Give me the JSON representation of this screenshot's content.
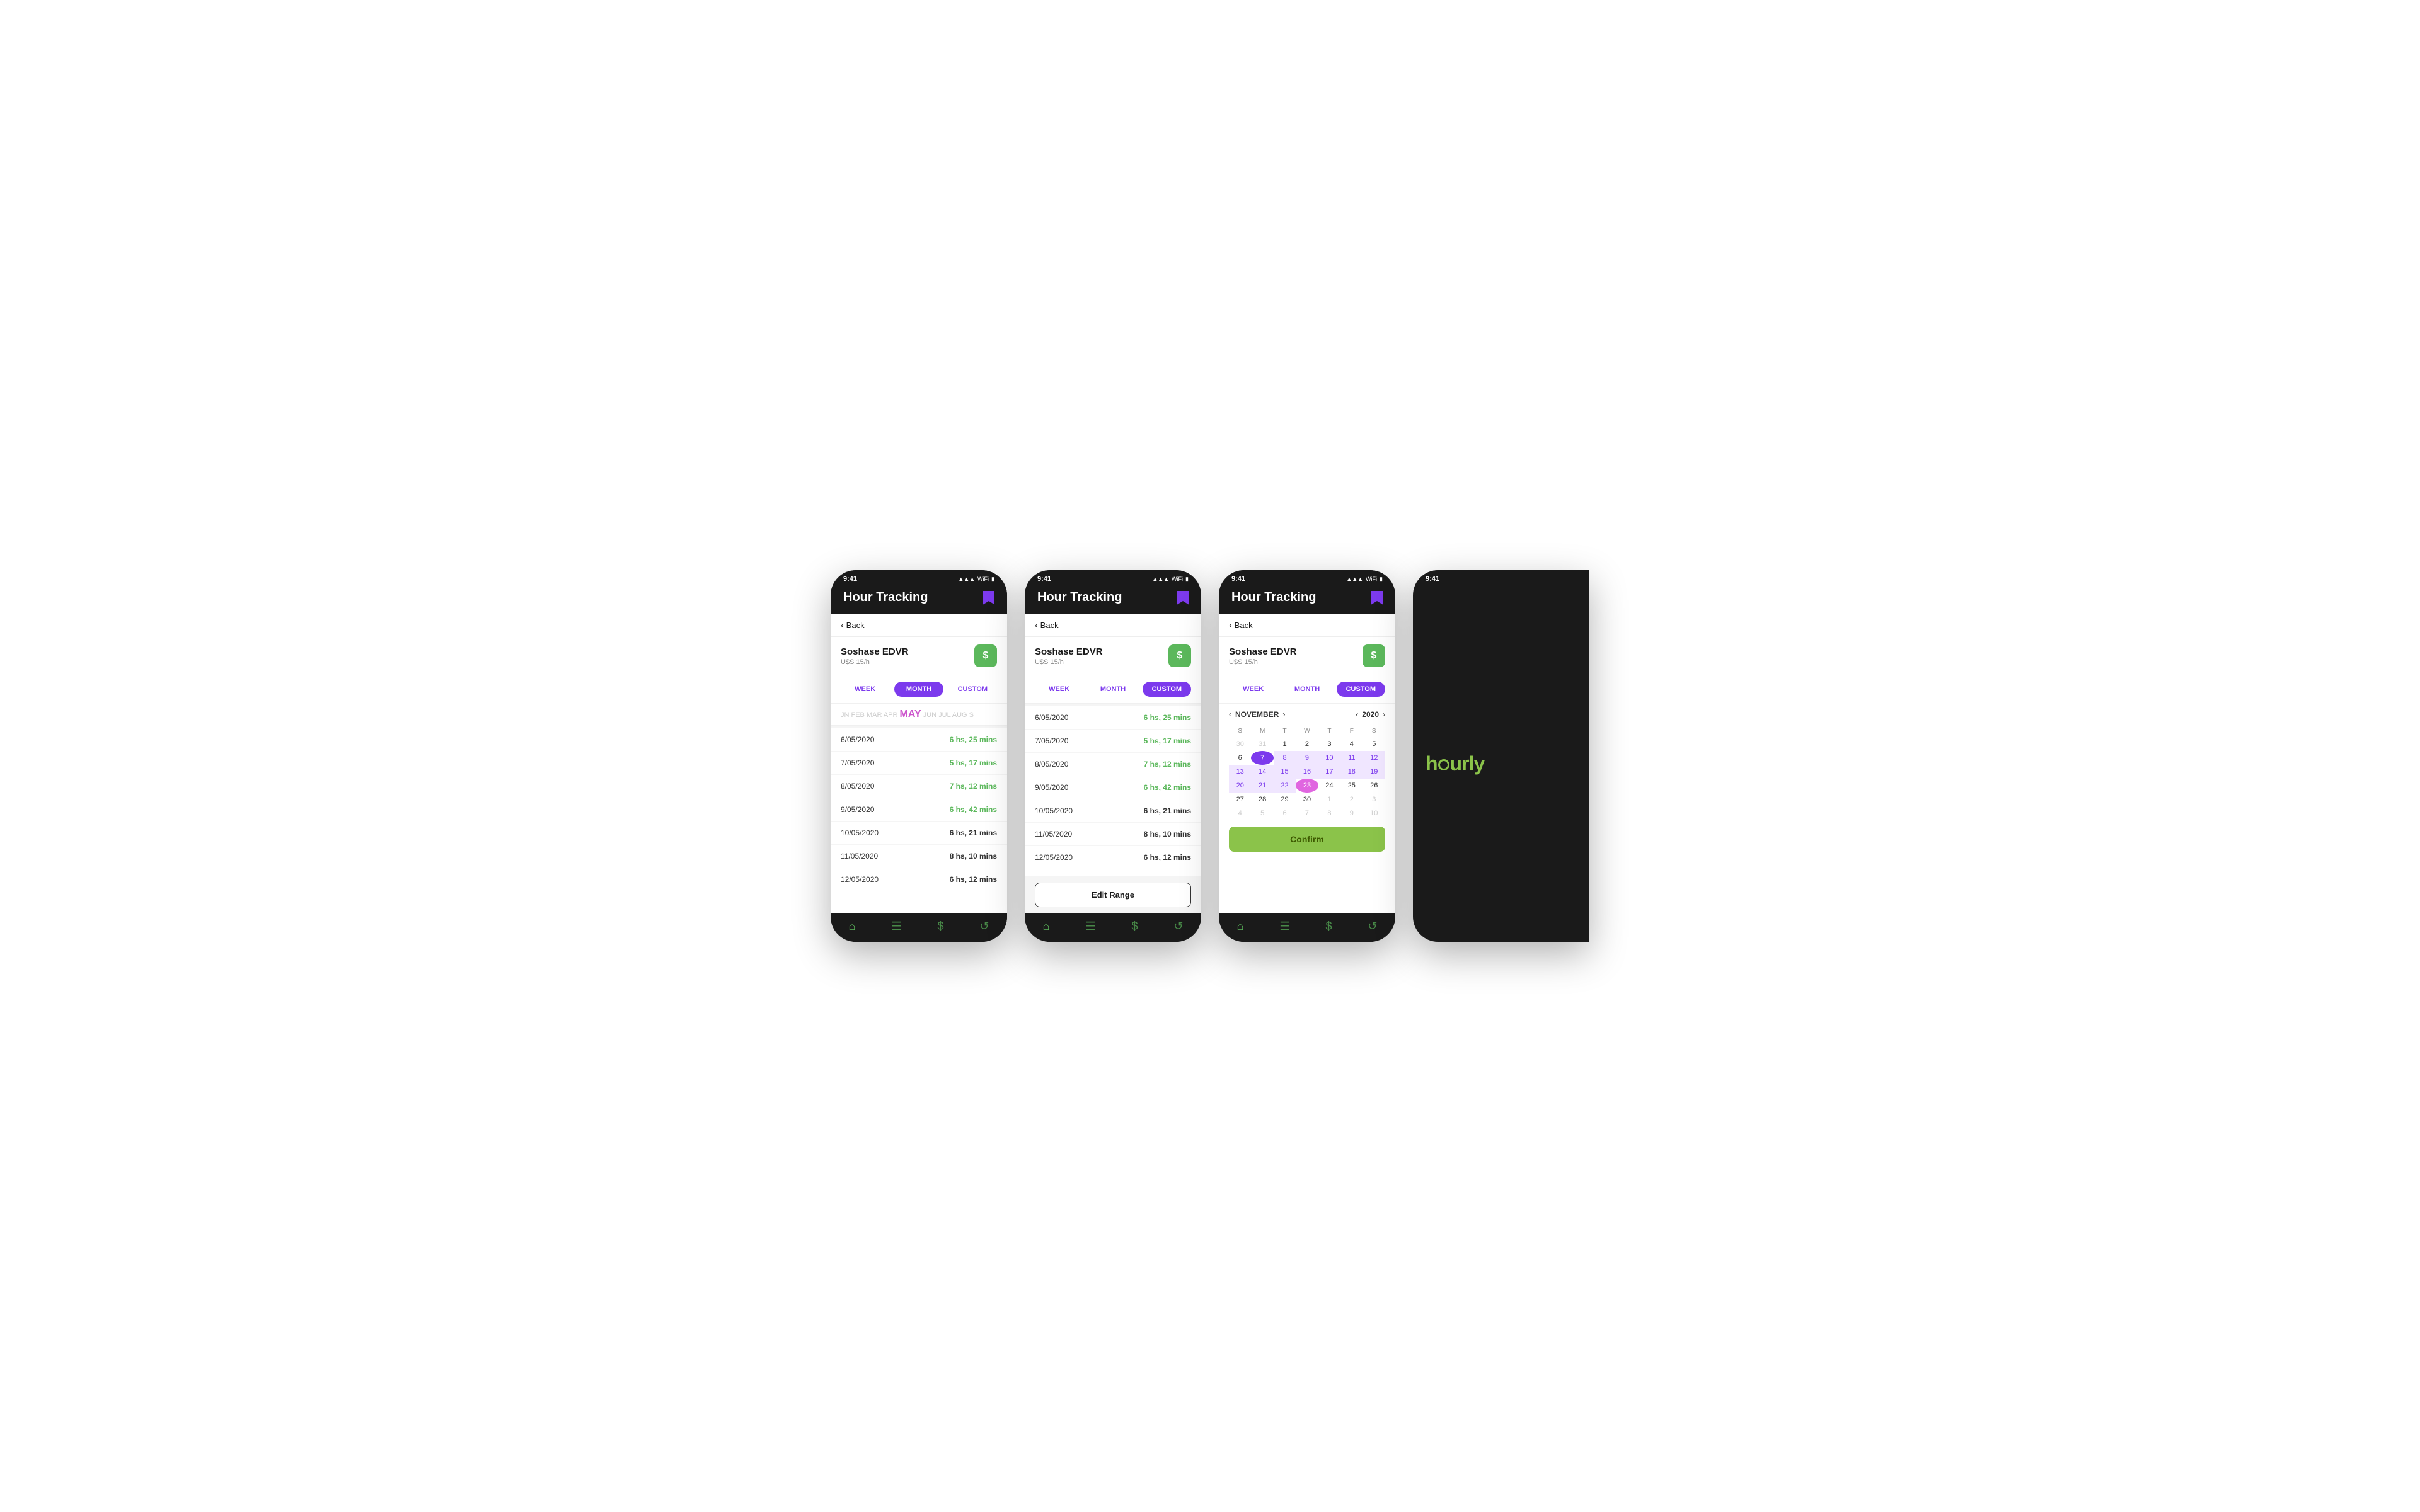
{
  "app": {
    "title": "Hour Tracking",
    "status_time": "9:41",
    "worker_name": "Soshase EDVR",
    "worker_rate": "U$S 15/h"
  },
  "tabs": {
    "week": "WEEK",
    "month": "MONTH",
    "custom": "CUSTOM"
  },
  "months_row": "JN  FEB  MAR  APR  MAY  JUN  JUL  AUG  S",
  "active_month": "MAY",
  "tracking_rows": [
    {
      "date": "6/05/2020",
      "hours": "6 hs, 25 mins",
      "highlight": true
    },
    {
      "date": "7/05/2020",
      "hours": "5 hs, 17 mins",
      "highlight": true
    },
    {
      "date": "8/05/2020",
      "hours": "7 hs, 12 mins",
      "highlight": true
    },
    {
      "date": "9/05/2020",
      "hours": "6 hs, 42 mins",
      "highlight": true
    },
    {
      "date": "10/05/2020",
      "hours": "6 hs, 21 mins",
      "highlight": false
    },
    {
      "date": "11/05/2020",
      "hours": "8 hs, 10 mins",
      "highlight": false
    },
    {
      "date": "12/05/2020",
      "hours": "6 hs, 12 mins",
      "highlight": false
    }
  ],
  "edit_range_label": "Edit Range",
  "confirm_label": "Confirm",
  "calendar": {
    "month": "NOVEMBER",
    "year": "2020",
    "days_header": [
      "S",
      "M",
      "T",
      "W",
      "T",
      "F",
      "S"
    ],
    "weeks": [
      [
        "30",
        "31",
        "1",
        "2",
        "3",
        "4",
        "5"
      ],
      [
        "6",
        "7",
        "8",
        "9",
        "10",
        "11",
        "12"
      ],
      [
        "13",
        "14",
        "15",
        "16",
        "17",
        "18",
        "19"
      ],
      [
        "20",
        "21",
        "22",
        "23",
        "24",
        "25",
        "26"
      ],
      [
        "27",
        "28",
        "29",
        "30",
        "1",
        "2",
        "3"
      ],
      [
        "4",
        "5",
        "6",
        "7",
        "8",
        "9",
        "10"
      ]
    ],
    "dimmed_cells": [
      "30",
      "31",
      "1",
      "2",
      "3",
      "4",
      "5",
      "1",
      "2",
      "3",
      "4",
      "5",
      "6",
      "7",
      "8",
      "9",
      "10"
    ],
    "range_start": "7",
    "range_end": "23",
    "range_weeks": [
      1,
      2,
      3
    ]
  },
  "nav_icons": [
    "⌂",
    "☰",
    "$",
    "↺"
  ],
  "splash": {
    "logo": "hourly"
  }
}
